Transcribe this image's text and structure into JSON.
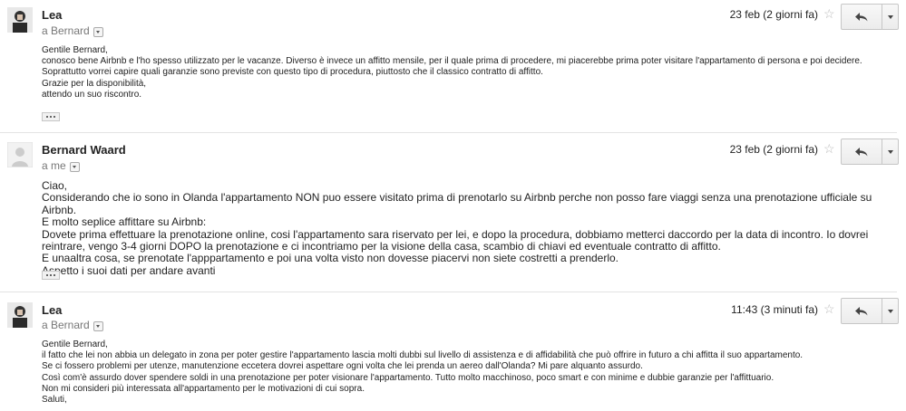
{
  "messages": [
    {
      "sender": "Lea",
      "recipient": "a Bernard",
      "date": "23 feb (2 giorni fa)",
      "body": "Gentile Bernard,\nconosco bene Airbnb e l'ho spesso utilizzato per le vacanze. Diverso è invece un affitto mensile, per il quale prima di procedere, mi piacerebbe prima poter visitare l'appartamento di persona e poi decidere.\nSoprattutto vorrei capire quali garanzie sono previste con questo tipo di procedura, piuttosto che il classico contratto di affitto.\nGrazie per la disponibilità,\nattendo un suo riscontro."
    },
    {
      "sender": "Bernard Waard",
      "recipient": "a me",
      "date": "23 feb (2 giorni fa)",
      "body": "Ciao,\nConsiderando che io sono in Olanda l'appartamento NON puo essere visitato prima di prenotarlo su Airbnb perche non posso fare viaggi senza una prenotazione ufficiale su Airbnb.\nE molto seplice affittare su Airbnb:\nDovete prima effettuare la prenotazione online, cosi l'appartamento sara riservato per lei, e dopo la procedura, dobbiamo metterci daccordo per la data di incontro. Io dovrei reintrare, vengo 3-4 giorni DOPO la prenotazione e ci incontriamo per la visione della casa, scambio di chiavi ed eventuale contratto di affitto.\nE unaaltra cosa, se prenotate l'apppartamento e poi una volta visto non dovesse piacervi non siete costretti a prenderlo.\nAspetto i suoi dati per andare avanti"
    },
    {
      "sender": "Lea",
      "recipient": "a Bernard",
      "date": "11:43 (3 minuti fa)",
      "body": "Gentile Bernard,\nil fatto che lei non abbia un delegato in zona per poter gestire l'appartamento lascia molti dubbi sul livello di assistenza e di affidabilità che può offrire in futuro a chi affitta il suo appartamento.\nSe ci fossero problemi per utenze, manutenzione eccetera dovrei aspettare ogni volta che lei prenda un aereo dall'Olanda? Mi pare alquanto assurdo.\nCosì com'è assurdo dover spendere soldi in una prenotazione per poter visionare l'appartamento. Tutto molto macchinoso, poco smart e con minime e dubbie garanzie per l'affittuario.\nNon mi consideri più interessata all'appartamento per le motivazioni di cui sopra.\nSaluti,"
    }
  ],
  "icons": {
    "star": "star-icon",
    "reply": "reply-arrow-icon",
    "more": "caret-down-icon",
    "ellipsis": "ellipsis-icon"
  },
  "colors": {
    "divider": "#e3e3e3",
    "meta_text": "#777777",
    "star": "#bbbbbb"
  }
}
